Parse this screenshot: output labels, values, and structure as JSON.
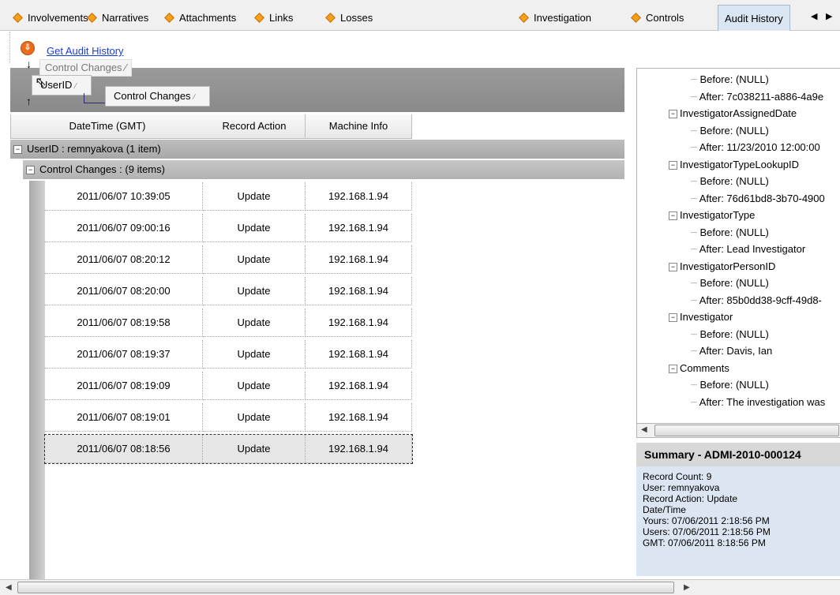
{
  "tabs": [
    {
      "label": "Involvements"
    },
    {
      "label": "Narratives"
    },
    {
      "label": "Attachments"
    },
    {
      "label": "Links"
    },
    {
      "label": "Losses"
    },
    {
      "label": "Investigation"
    },
    {
      "label": "Controls"
    },
    {
      "label": "Audit History",
      "active": true
    }
  ],
  "toolbar": {
    "get_audit_history": "Get Audit History"
  },
  "group_area": {
    "drag_ghost": "Control Changes",
    "chip_userid": "UserID",
    "chip_control_changes": "Control Changes"
  },
  "columns": [
    "DateTime (GMT)",
    "Record Action",
    "Machine Info"
  ],
  "groups": {
    "user": "UserID : remnyakova (1 item)",
    "control": "Control Changes :  (9 items)"
  },
  "rows": [
    {
      "datetime": "2011/06/07 10:39:05",
      "action": "Update",
      "machine": "192.168.1.94"
    },
    {
      "datetime": "2011/06/07 09:00:16",
      "action": "Update",
      "machine": "192.168.1.94"
    },
    {
      "datetime": "2011/06/07 08:20:12",
      "action": "Update",
      "machine": "192.168.1.94"
    },
    {
      "datetime": "2011/06/07 08:20:00",
      "action": "Update",
      "machine": "192.168.1.94"
    },
    {
      "datetime": "2011/06/07 08:19:58",
      "action": "Update",
      "machine": "192.168.1.94"
    },
    {
      "datetime": "2011/06/07 08:19:37",
      "action": "Update",
      "machine": "192.168.1.94"
    },
    {
      "datetime": "2011/06/07 08:19:09",
      "action": "Update",
      "machine": "192.168.1.94"
    },
    {
      "datetime": "2011/06/07 08:19:01",
      "action": "Update",
      "machine": "192.168.1.94"
    },
    {
      "datetime": "2011/06/07 08:18:56",
      "action": "Update",
      "machine": "192.168.1.94",
      "selected": true
    }
  ],
  "tree": [
    {
      "text": "Before: (NULL)"
    },
    {
      "text": "After: 7c038211-a886-4a9e"
    },
    {
      "text": "InvestigatorAssignedDate"
    },
    {
      "text": "Before: (NULL)"
    },
    {
      "text": "After: 11/23/2010 12:00:00"
    },
    {
      "text": "InvestigatorTypeLookupID"
    },
    {
      "text": "Before: (NULL)"
    },
    {
      "text": "After: 76d61bd8-3b70-4900"
    },
    {
      "text": "InvestigatorType"
    },
    {
      "text": "Before: (NULL)"
    },
    {
      "text": "After: Lead Investigator"
    },
    {
      "text": "InvestigatorPersonID"
    },
    {
      "text": "Before: (NULL)"
    },
    {
      "text": "After: 85b0dd38-9cff-49d8-"
    },
    {
      "text": "Investigator"
    },
    {
      "text": "Before: (NULL)"
    },
    {
      "text": "After: Davis, Ian"
    },
    {
      "text": "Comments"
    },
    {
      "text": "Before: (NULL)"
    },
    {
      "text": "After: The investigation was"
    }
  ],
  "summary": {
    "title": "Summary - ADMI-2010-000124",
    "lines": [
      "Record Count: 9",
      "User: remnyakova",
      "Record Action: Update",
      "Date/Time",
      "Yours: 07/06/2011 2:18:56 PM",
      "Users: 07/06/2011 2:18:56 PM",
      "GMT: 07/06/2011 8:18:56 PM"
    ]
  },
  "icons": {
    "tab_marker": "diamond-icon",
    "get_audit": "audit-download-icon",
    "sort": "sort-arrow-icon"
  }
}
